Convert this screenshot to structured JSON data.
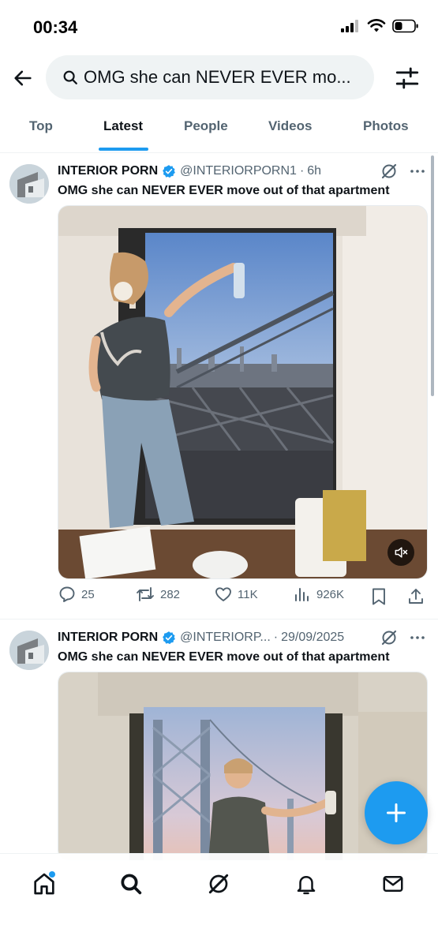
{
  "status_bar": {
    "time": "00:34"
  },
  "search": {
    "query": "OMG she can NEVER EVER mo..."
  },
  "tabs": [
    {
      "label": "Top",
      "active": false
    },
    {
      "label": "Latest",
      "active": true
    },
    {
      "label": "People",
      "active": false
    },
    {
      "label": "Videos",
      "active": false
    },
    {
      "label": "Photos",
      "active": false
    }
  ],
  "tweets": [
    {
      "author_name": "INTERIOR PORN",
      "handle": "@INTERIORPORN1",
      "separator": "·",
      "time": "6h",
      "text": "OMG she can NEVER EVER move out of that apartment",
      "stats": {
        "replies": "25",
        "reposts": "282",
        "likes": "11K",
        "views": "926K"
      }
    },
    {
      "author_name": "INTERIOR PORN",
      "handle": "@INTERIORP...",
      "separator": "·",
      "time": "29/09/2025",
      "text": "OMG she can NEVER EVER move out of that apartment"
    }
  ],
  "colors": {
    "accent": "#1d9bf0",
    "text_secondary": "#536471"
  },
  "icons": [
    "back-arrow-icon",
    "search-icon",
    "filter-sliders-icon",
    "verified-badge-icon",
    "grok-icon",
    "more-icon",
    "reply-icon",
    "repost-icon",
    "like-icon",
    "views-icon",
    "bookmark-icon",
    "share-icon",
    "mute-icon",
    "compose-plus-icon",
    "home-icon",
    "notifications-icon",
    "messages-icon"
  ]
}
